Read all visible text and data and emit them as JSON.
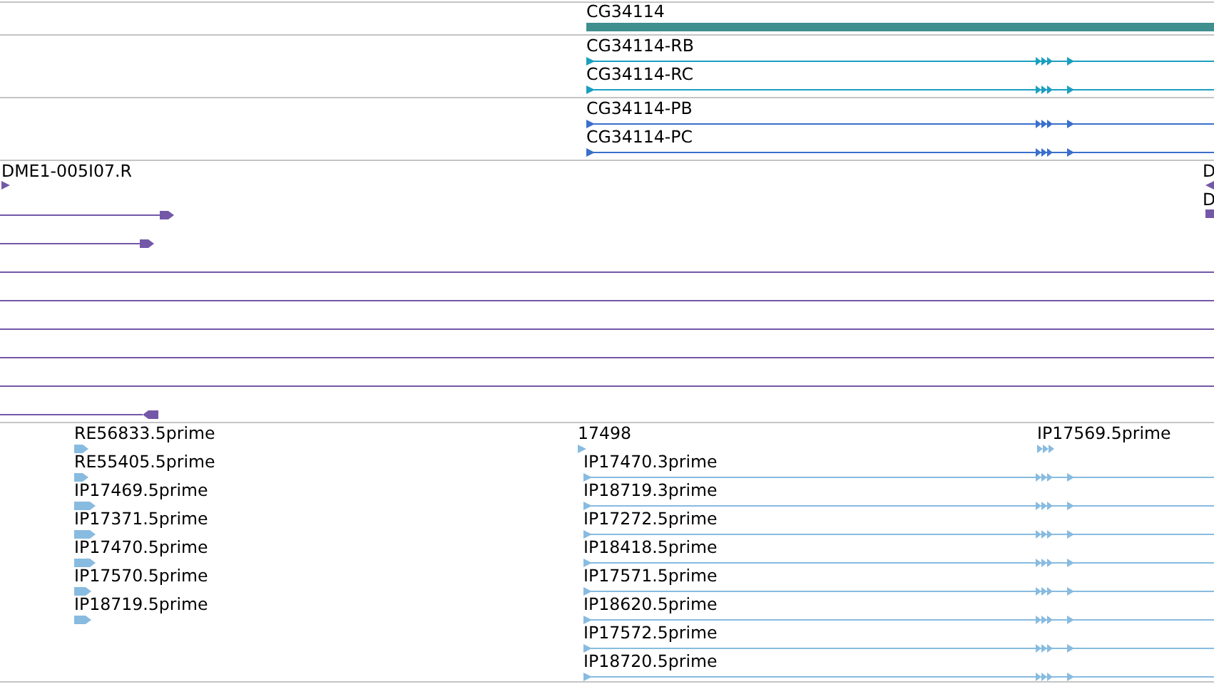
{
  "tracks": [
    {
      "kind": "gene",
      "color": "#3f8f8f",
      "features": [
        {
          "label": "CG34114"
        }
      ]
    },
    {
      "kind": "transcript",
      "color": "#1b9fc0",
      "features": [
        {
          "label": "CG34114-RB"
        },
        {
          "label": "CG34114-RC"
        }
      ]
    },
    {
      "kind": "transcript",
      "color": "#3a6fcc",
      "features": [
        {
          "label": "CG34114-PB"
        },
        {
          "label": "CG34114-PC"
        }
      ]
    },
    {
      "kind": "alignment",
      "color": "#7458a8",
      "features": [
        {
          "label": "DME1-005I07.R"
        },
        {
          "label": "D"
        },
        {
          "label": "D"
        }
      ]
    },
    {
      "kind": "est",
      "color": "#88bbe0",
      "features": [
        {
          "label": "RE56833.5prime"
        },
        {
          "label": "RE55405.5prime"
        },
        {
          "label": "IP17469.5prime"
        },
        {
          "label": "IP17371.5prime"
        },
        {
          "label": "IP17470.5prime"
        },
        {
          "label": "IP17570.5prime"
        },
        {
          "label": "IP18719.5prime"
        },
        {
          "label": "17498"
        },
        {
          "label": "IP17470.3prime"
        },
        {
          "label": "IP18719.3prime"
        },
        {
          "label": "IP17272.5prime"
        },
        {
          "label": "IP18418.5prime"
        },
        {
          "label": "IP17571.5prime"
        },
        {
          "label": "IP18620.5prime"
        },
        {
          "label": "IP17572.5prime"
        },
        {
          "label": "IP18720.5prime"
        },
        {
          "label": "IP17569.5prime"
        }
      ]
    }
  ]
}
